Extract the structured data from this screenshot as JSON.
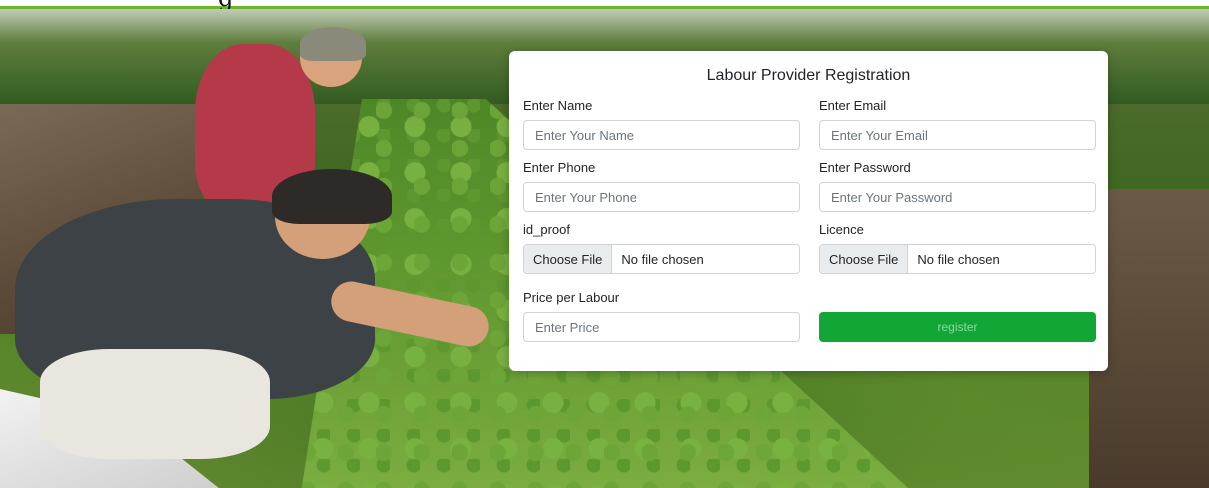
{
  "page": {
    "accent_color": "#6fb52c",
    "cut_heading_fragment": "g"
  },
  "form": {
    "title": "Labour Provider Registration",
    "name": {
      "label": "Enter Name",
      "placeholder": "Enter Your Name"
    },
    "email": {
      "label": "Enter Email",
      "placeholder": "Enter Your Email"
    },
    "phone": {
      "label": "Enter Phone",
      "placeholder": "Enter Your Phone"
    },
    "password": {
      "label": "Enter Password",
      "placeholder": "Enter Your Password"
    },
    "id_proof": {
      "label": "id_proof",
      "button_label": "Choose File",
      "status": "No file chosen"
    },
    "licence": {
      "label": "Licence",
      "button_label": "Choose File",
      "status": "No file chosen"
    },
    "price": {
      "label": "Price per Labour",
      "placeholder": "Enter Price"
    },
    "register_label": "register",
    "register_color": "#12a637"
  }
}
